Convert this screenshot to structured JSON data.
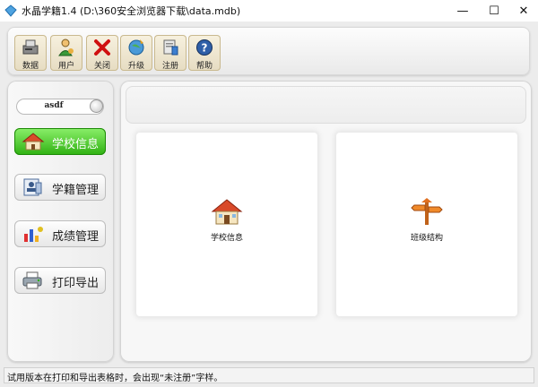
{
  "window": {
    "title": "水晶学籍1.4",
    "path": "(D:\\360安全浏览器下载\\data.mdb)",
    "min_symbol": "—",
    "max_symbol": "☐",
    "close_symbol": "✕"
  },
  "toolbar": {
    "items": [
      {
        "label": "数据",
        "icon": "database-icon"
      },
      {
        "label": "用户",
        "icon": "user-icon"
      },
      {
        "label": "关闭",
        "icon": "close-x-icon"
      },
      {
        "label": "升级",
        "icon": "upgrade-icon"
      },
      {
        "label": "注册",
        "icon": "register-icon"
      },
      {
        "label": "帮助",
        "icon": "help-icon"
      }
    ]
  },
  "sidebar": {
    "user_value": "asdf",
    "items": [
      {
        "label": "学校信息",
        "icon": "school-house-icon",
        "active": true
      },
      {
        "label": "学籍管理",
        "icon": "student-record-icon",
        "active": false
      },
      {
        "label": "成绩管理",
        "icon": "grades-chart-icon",
        "active": false
      },
      {
        "label": "打印导出",
        "icon": "printer-icon",
        "active": false
      }
    ]
  },
  "content": {
    "cards": [
      {
        "label": "学校信息",
        "icon": "school-house-icon"
      },
      {
        "label": "班级结构",
        "icon": "class-structure-icon"
      }
    ]
  },
  "status": {
    "message": "试用版本在打印和导出表格时，会出现“未注册”字样。"
  },
  "colors": {
    "active_nav": "#2fb112",
    "frame_bg": "#ececec"
  }
}
